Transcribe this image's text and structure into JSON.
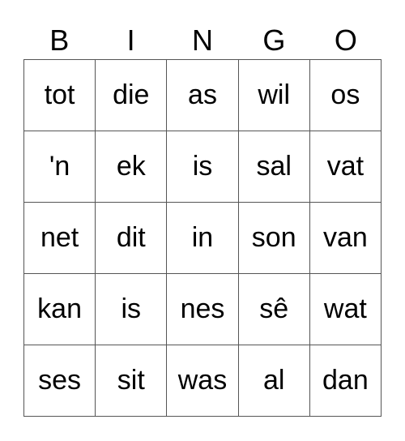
{
  "header": [
    "B",
    "I",
    "N",
    "G",
    "O"
  ],
  "cells": [
    [
      "tot",
      "die",
      "as",
      "wil",
      "os"
    ],
    [
      "'n",
      "ek",
      "is",
      "sal",
      "vat"
    ],
    [
      "net",
      "dit",
      "in",
      "son",
      "van"
    ],
    [
      "kan",
      "is",
      "nes",
      "sê",
      "wat"
    ],
    [
      "ses",
      "sit",
      "was",
      "al",
      "dan"
    ]
  ]
}
